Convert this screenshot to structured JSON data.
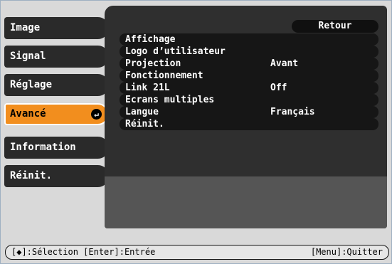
{
  "sidebar": {
    "items": [
      {
        "label": "Image"
      },
      {
        "label": "Signal"
      },
      {
        "label": "Réglage"
      },
      {
        "label": "Avancé",
        "active": true
      },
      {
        "label": "Information"
      },
      {
        "label": "Réinit."
      }
    ]
  },
  "panel": {
    "return_label": "Retour",
    "rows": [
      {
        "label": "Affichage",
        "value": ""
      },
      {
        "label": "Logo d’utilisateur",
        "value": ""
      },
      {
        "label": "Projection",
        "value": "Avant"
      },
      {
        "label": "Fonctionnement",
        "value": ""
      },
      {
        "label": "Link 21L",
        "value": "Off"
      },
      {
        "label": "Ecrans multiples",
        "value": ""
      },
      {
        "label": "Langue",
        "value": "Français"
      },
      {
        "label": "Réinit.",
        "value": ""
      }
    ]
  },
  "statusbar": {
    "left": "[◆]:Sélection [Enter]:Entrée",
    "right": "[Menu]:Quitter"
  },
  "colors": {
    "active_item": "#f28e1e",
    "item_bg": "#2a2a2a",
    "panel_bg": "#2f2f2f"
  }
}
